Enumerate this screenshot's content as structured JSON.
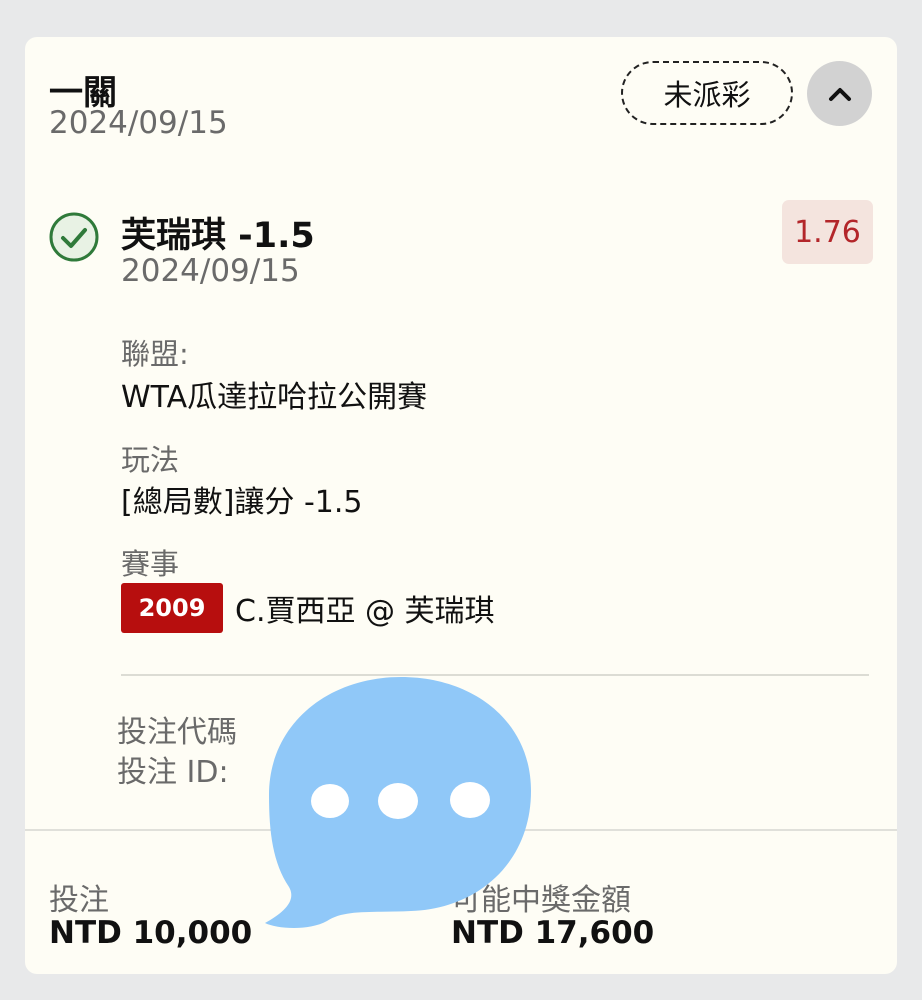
{
  "header": {
    "bet_type": "一關",
    "date": "2024/09/15",
    "status": "未派彩",
    "collapse_icon": "chevron-up-icon"
  },
  "selection": {
    "title": "芙瑞琪 -1.5",
    "date": "2024/09/15",
    "odds": "1.76",
    "status_icon": "check-circle-icon"
  },
  "details": {
    "league_label": "聯盟:",
    "league_value": "WTA瓜達拉哈拉公開賽",
    "play_label": "玩法",
    "play_value": "[總局數]讓分 -1.5",
    "event_label": "賽事",
    "event_code": "2009",
    "event_name": "C.賈西亞 @ 芙瑞琪"
  },
  "bet_codes": {
    "code_label": "投注代碼",
    "id_label": "投注 ID:"
  },
  "footer": {
    "stake_label": "投注",
    "stake_value": "NTD 10,000",
    "payout_label": "可能中獎金額",
    "payout_value": "NTD 17,600"
  },
  "colors": {
    "card_bg": "#fefdf5",
    "odds_text": "#b3262a",
    "odds_bg": "#f4e4de",
    "event_code_bg": "#b70e0e",
    "check_green": "#2f7a3a",
    "bubble_blue": "#90c8f8"
  },
  "overlay": {
    "icon": "chat-bubble-ellipsis-icon"
  }
}
